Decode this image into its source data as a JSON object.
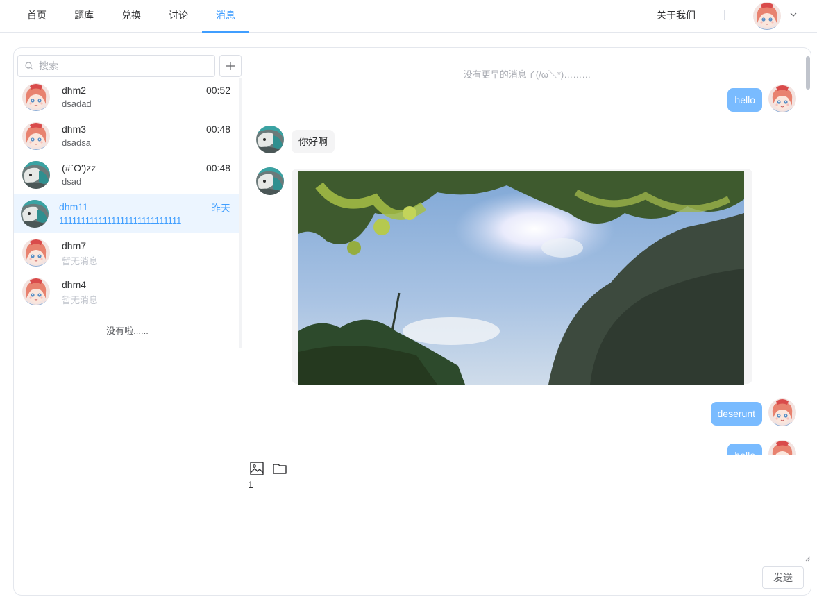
{
  "nav": {
    "items": [
      {
        "label": "首页"
      },
      {
        "label": "题库"
      },
      {
        "label": "兑换"
      },
      {
        "label": "讨论"
      },
      {
        "label": "消息"
      }
    ],
    "active_index": 4,
    "about_label": "关于我们",
    "user_menu_icon": "chevron-down-icon"
  },
  "sidebar": {
    "search_placeholder": "搜索",
    "add_icon": "plus-icon",
    "conversations": [
      {
        "name": "dhm2",
        "preview": "dsadad",
        "time": "00:52",
        "avatar": "anime-girl"
      },
      {
        "name": "dhm3",
        "preview": "dsadsa",
        "time": "00:48",
        "avatar": "anime-girl"
      },
      {
        "name": "(#`O′)zz",
        "preview": "dsad",
        "time": "00:48",
        "avatar": "teal-character"
      },
      {
        "name": "dhm11",
        "preview": "1111111111111111111111111111",
        "time": "昨天",
        "avatar": "teal-character",
        "active": true
      },
      {
        "name": "dhm7",
        "preview": "暂无消息",
        "time": "",
        "avatar": "anime-girl",
        "empty": true
      },
      {
        "name": "dhm4",
        "preview": "暂无消息",
        "time": "",
        "avatar": "anime-girl",
        "empty": true
      }
    ],
    "end_text": "没有啦......"
  },
  "chat": {
    "no_earlier_text": "没有更早的消息了(/ω＼*)………",
    "messages": [
      {
        "from": "me",
        "text": "hello"
      },
      {
        "from": "them",
        "text": "你好啊"
      },
      {
        "from": "them",
        "type": "image",
        "description": "sky-and-trees-photo"
      },
      {
        "from": "me",
        "text": "deserunt"
      },
      {
        "from": "me",
        "text": "hello"
      }
    ]
  },
  "composer": {
    "tools": [
      "image-icon",
      "folder-icon"
    ],
    "draft": "1",
    "send_label": "发送"
  },
  "colors": {
    "accent": "#409eff",
    "my_bubble": "#79bbff",
    "their_bubble": "#f4f4f5",
    "active_row": "#ecf5ff"
  }
}
